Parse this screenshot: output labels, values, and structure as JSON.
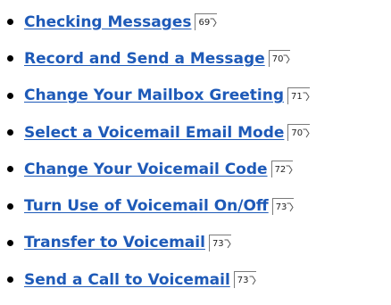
{
  "items": [
    {
      "label": "Checking Messages",
      "page": "69"
    },
    {
      "label": "Record and Send a Message",
      "page": "70"
    },
    {
      "label": "Change Your Mailbox Greeting",
      "page": "71"
    },
    {
      "label": "Select a Voicemail Email Mode",
      "page": "70"
    },
    {
      "label": "Change Your Voicemail Code",
      "page": "72"
    },
    {
      "label": "Turn Use of Voicemail On/Off",
      "page": "73"
    },
    {
      "label": "Transfer to Voicemail",
      "page": "73"
    },
    {
      "label": "Send a Call to Voicemail",
      "page": "73"
    }
  ],
  "colors": {
    "link": "#1e5ab8"
  },
  "icon": "page-jump-arrow-icon"
}
